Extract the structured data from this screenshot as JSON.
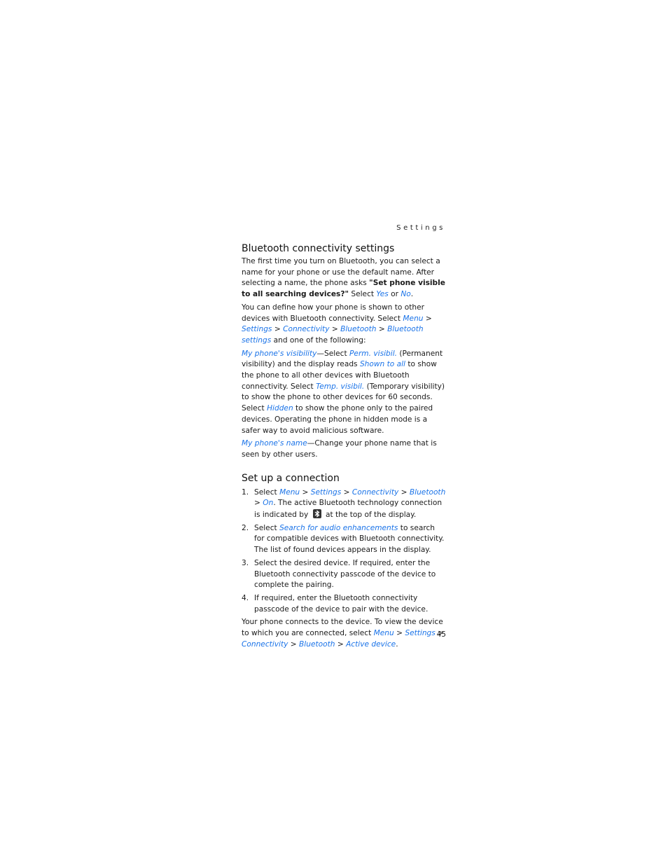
{
  "running_head": "Settings",
  "page_number": "45",
  "colors": {
    "link": "#1a73e8",
    "text": "#1a1a1a"
  },
  "section1": {
    "title": "Bluetooth connectivity settings",
    "p1": {
      "t1": "The first time you turn on Bluetooth, you can select a name for your phone or use the default name. After selecting a name, the phone asks ",
      "bold": "\"Set phone visible to all searching devices?\"",
      "t2": " Select ",
      "link_yes": "Yes",
      "t3": " or ",
      "link_no": "No",
      "t4": "."
    },
    "p2": {
      "t1": "You can define how your phone is shown to other devices with Bluetooth connectivity. Select ",
      "links": [
        "Menu",
        "Settings",
        "Connectivity",
        "Bluetooth",
        "Bluetooth settings"
      ],
      "sep": " > ",
      "t2": " and one of the following:"
    },
    "p3": {
      "link1": "My phone's visibility",
      "t1": "—Select ",
      "link2": "Perm. visibil.",
      "t2": " (Permanent visibility) and the display reads ",
      "link3": "Shown to all",
      "t3": " to show the phone to all other devices with Bluetooth connectivity. Select ",
      "link4": "Temp. visibil.",
      "t4": " (Temporary visibility) to show the phone to other devices for 60 seconds. Select ",
      "link5": "Hidden",
      "t5": " to show the phone only to the paired devices. Operating the phone in hidden mode is a safer way to avoid malicious software."
    },
    "p4": {
      "link1": "My phone's name",
      "t1": "—Change your phone name that is seen by other users."
    }
  },
  "section2": {
    "title": "Set up a connection",
    "steps": [
      {
        "num": "1.",
        "t1": "Select ",
        "links": [
          "Menu",
          "Settings",
          "Connectivity",
          "Bluetooth",
          "On"
        ],
        "t2": ". The active Bluetooth technology connection is indicated by ",
        "icon": "bluetooth-icon",
        "t3": " at the top of the display."
      },
      {
        "num": "2.",
        "t1": "Select ",
        "link": "Search for audio enhancements",
        "t2": " to search for compatible devices with Bluetooth connectivity. The list of found devices appears in the display."
      },
      {
        "num": "3.",
        "text": "Select the desired device. If required, enter the Bluetooth connectivity passcode of the device to complete the pairing."
      },
      {
        "num": "4.",
        "text": "If required, enter the Bluetooth connectivity passcode of the device to pair with the device."
      }
    ],
    "closing": {
      "t1": "Your phone connects to the device. To view the device to which you are connected, select ",
      "links": [
        "Menu",
        "Settings",
        "Connectivity",
        "Bluetooth",
        "Active device"
      ],
      "t2": "."
    }
  }
}
